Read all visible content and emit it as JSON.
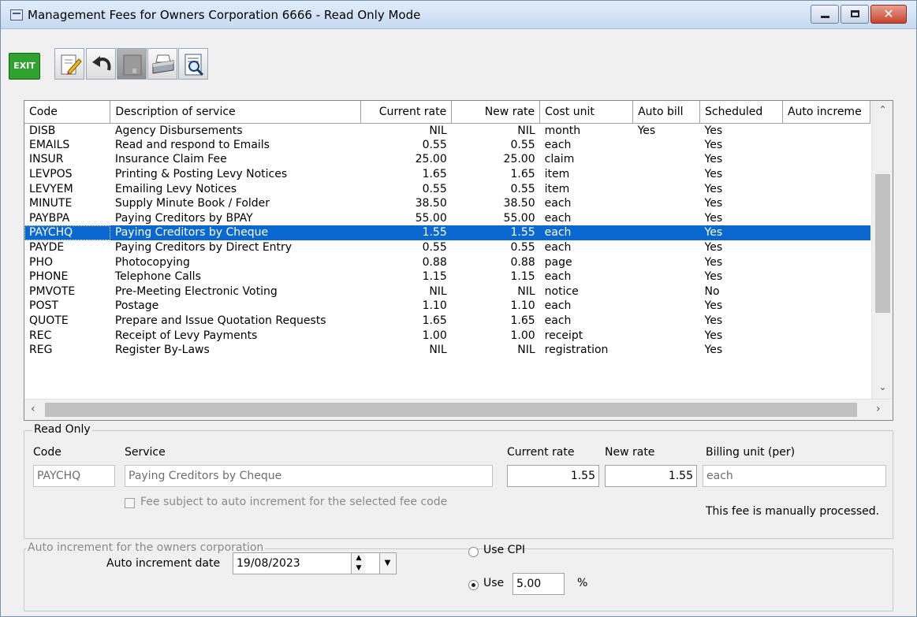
{
  "window": {
    "title": "Management Fees for Owners Corporation 6666 - Read Only Mode",
    "minimize": "minimize",
    "maximize": "maximize",
    "close": "✕"
  },
  "toolbar": {
    "exit_label": "EXIT",
    "icons": [
      "exit-icon",
      "edit-icon",
      "undo-icon",
      "save-icon",
      "print-icon",
      "print-preview-icon"
    ]
  },
  "grid": {
    "columns": [
      "Code",
      "Description of service",
      "Current rate",
      "New rate",
      "Cost unit",
      "Auto bill",
      "Scheduled",
      "Auto increme"
    ],
    "rows": [
      [
        "DISB",
        "Agency Disbursements",
        "NIL",
        "NIL",
        "month",
        "Yes",
        "Yes",
        ""
      ],
      [
        "EMAILS",
        "Read and respond to Emails",
        "0.55",
        "0.55",
        "each",
        "",
        "Yes",
        ""
      ],
      [
        "INSUR",
        "Insurance Claim Fee",
        "25.00",
        "25.00",
        "claim",
        "",
        "Yes",
        ""
      ],
      [
        "LEVPOS",
        "Printing & Posting Levy Notices",
        "1.65",
        "1.65",
        "item",
        "",
        "Yes",
        ""
      ],
      [
        "LEVYEM",
        "Emailing Levy Notices",
        "0.55",
        "0.55",
        "item",
        "",
        "Yes",
        ""
      ],
      [
        "MINUTE",
        "Supply Minute Book / Folder",
        "38.50",
        "38.50",
        "each",
        "",
        "Yes",
        ""
      ],
      [
        "PAYBPA",
        "Paying Creditors by BPAY",
        "55.00",
        "55.00",
        "each",
        "",
        "Yes",
        ""
      ],
      [
        "PAYCHQ",
        "Paying Creditors by Cheque",
        "1.55",
        "1.55",
        "each",
        "",
        "Yes",
        ""
      ],
      [
        "PAYDE",
        "Paying Creditors by Direct Entry",
        "0.55",
        "0.55",
        "each",
        "",
        "Yes",
        ""
      ],
      [
        "PHO",
        "Photocopying",
        "0.88",
        "0.88",
        "page",
        "",
        "Yes",
        ""
      ],
      [
        "PHONE",
        "Telephone Calls",
        "1.15",
        "1.15",
        "each",
        "",
        "Yes",
        ""
      ],
      [
        "PMVOTE",
        "Pre-Meeting Electronic Voting",
        "NIL",
        "NIL",
        "notice",
        "",
        "No",
        ""
      ],
      [
        "POST",
        "Postage",
        "1.10",
        "1.10",
        "each",
        "",
        "Yes",
        ""
      ],
      [
        "QUOTE",
        "Prepare and Issue Quotation Requests",
        "1.65",
        "1.65",
        "each",
        "",
        "Yes",
        ""
      ],
      [
        "REC",
        "Receipt of Levy Payments",
        "1.00",
        "1.00",
        "receipt",
        "",
        "Yes",
        ""
      ],
      [
        "REG",
        "Register By-Laws",
        "NIL",
        "NIL",
        "registration",
        "",
        "Yes",
        ""
      ]
    ],
    "selected_index": 7
  },
  "read_only": {
    "legend": "Read Only",
    "code_label": "Code",
    "service_label": "Service",
    "current_rate_label": "Current rate",
    "new_rate_label": "New rate",
    "billing_unit_label": "Billing unit (per)",
    "code_value": "PAYCHQ",
    "service_value": "Paying Creditors by Cheque",
    "current_rate_value": "1.55",
    "new_rate_value": "1.55",
    "billing_unit_value": "each",
    "auto_increment_checkbox_label": "Fee subject to auto increment for the selected fee code",
    "manual_note": "This fee is manually processed."
  },
  "auto_increment": {
    "legend": "Auto increment for the owners corporation",
    "date_label": "Auto increment date",
    "date_value": "19/08/2023",
    "use_cpi_label": "Use CPI",
    "use_label": "Use",
    "use_value": "5.00",
    "percent_label": "%",
    "selected_option": "use"
  },
  "colors": {
    "selection": "#0a68d0",
    "exit_button": "#2fa22f",
    "close_button": "#c7432b"
  }
}
